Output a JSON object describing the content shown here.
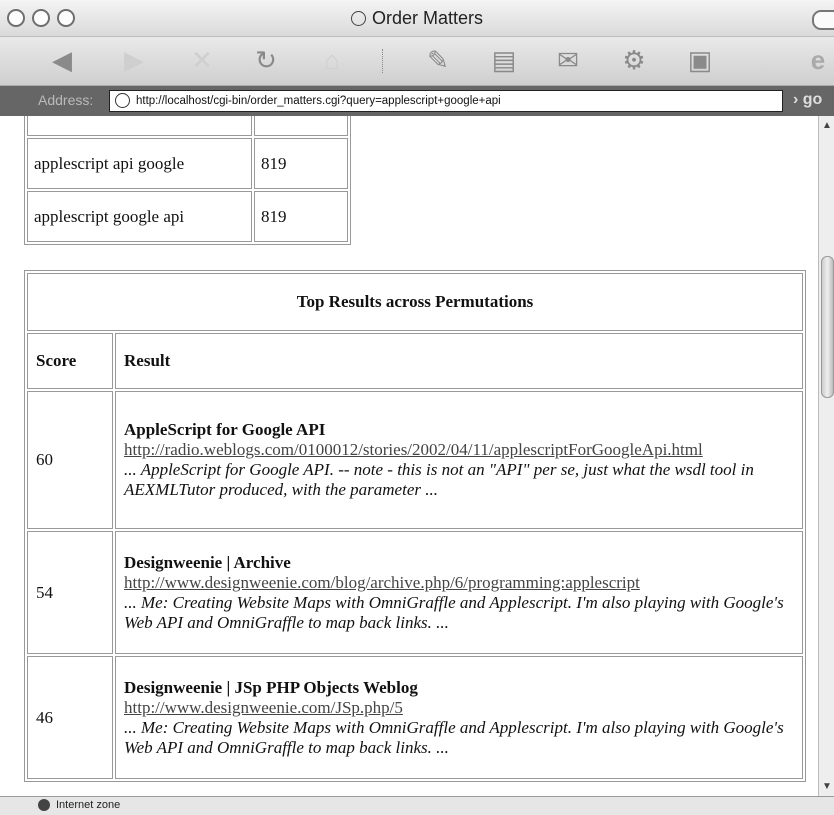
{
  "window": {
    "title": "Order Matters"
  },
  "toolbar": {
    "buttons": [
      {
        "name": "back-button",
        "icon": "back-arrow-icon",
        "glyph": "◀"
      },
      {
        "name": "forward-button",
        "icon": "forward-arrow-icon",
        "glyph": "▶"
      },
      {
        "name": "stop-button",
        "icon": "stop-icon",
        "glyph": "✕"
      },
      {
        "name": "refresh-button",
        "icon": "refresh-icon",
        "glyph": "↻"
      },
      {
        "name": "home-button",
        "icon": "home-icon",
        "glyph": "⌂"
      },
      {
        "name": "autofill-button",
        "icon": "autofill-icon",
        "glyph": "✎"
      },
      {
        "name": "print-button",
        "icon": "print-icon",
        "glyph": "▤"
      },
      {
        "name": "mail-button",
        "icon": "mail-icon",
        "glyph": "✉"
      },
      {
        "name": "preferences-button",
        "icon": "preferences-icon",
        "glyph": "⚙"
      },
      {
        "name": "edit-button",
        "icon": "edit-icon",
        "glyph": "▣"
      },
      {
        "name": "explorer-button",
        "icon": "explorer-logo-icon",
        "glyph": "e"
      }
    ]
  },
  "address": {
    "label": "Address:",
    "url": "http://localhost/cgi-bin/order_matters.cgi?query=applescript+google+api",
    "go_label": "go"
  },
  "permutations": [
    {
      "query": "applescript api google",
      "count": "819"
    },
    {
      "query": "applescript google api",
      "count": "819"
    }
  ],
  "results": {
    "caption": "Top Results across Permutations",
    "headers": {
      "score": "Score",
      "result": "Result"
    },
    "rows": [
      {
        "score": "60",
        "title": "AppleScript for Google API",
        "url": "http://radio.weblogs.com/0100012/stories/2002/04/11/applescriptForGoogleApi.html",
        "snippet": "... AppleScript for Google API. -- note - this is not an \"API\" per se, just what the wsdl tool in AEXMLTutor produced, with the parameter ..."
      },
      {
        "score": "54",
        "title": "Designweenie | Archive",
        "url": "http://www.designweenie.com/blog/archive.php/6/programming:applescript",
        "snippet": "... Me: Creating Website Maps with OmniGraffle and Applescript. I'm also playing with Google's Web API and OmniGraffle to map back links. ..."
      },
      {
        "score": "46",
        "title": "Designweenie | JSp PHP Objects Weblog",
        "url": "http://www.designweenie.com/JSp.php/5",
        "snippet": "... Me: Creating Website Maps with OmniGraffle and Applescript. I'm also playing with Google's Web API and OmniGraffle to map back links. ..."
      }
    ]
  },
  "status": {
    "zone": "Internet zone"
  }
}
